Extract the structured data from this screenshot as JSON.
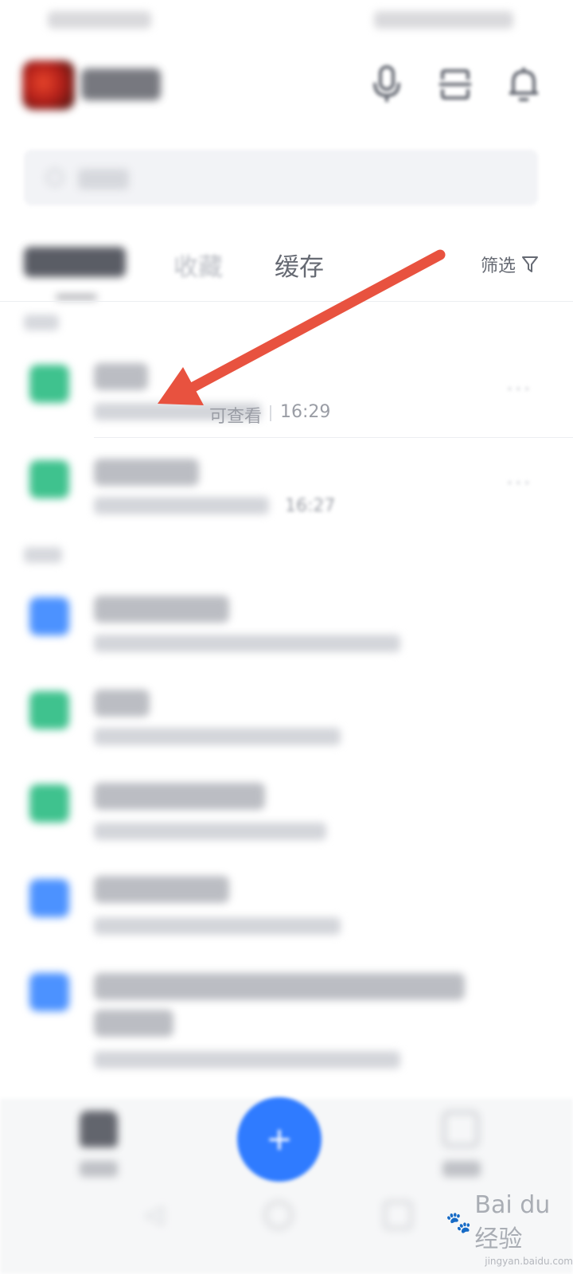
{
  "tabs": {
    "favorites": "收藏",
    "cache": "缓存"
  },
  "filter": {
    "label": "筛选",
    "icon": "filter-icon"
  },
  "list": [
    {
      "type": "sheet",
      "color": "#3fc28e",
      "meta_visible": "可查看",
      "time": "16:29"
    },
    {
      "type": "sheet",
      "color": "#3fc28e",
      "time": "16:27"
    },
    {
      "type": "doc",
      "color": "#4c92ff"
    },
    {
      "type": "sheet",
      "color": "#3fc28e"
    },
    {
      "type": "sheet",
      "color": "#3fc28e"
    },
    {
      "type": "doc",
      "color": "#4c92ff"
    },
    {
      "type": "doc",
      "color": "#4c92ff"
    }
  ],
  "fab_label": "+",
  "header_icons": [
    "microphone-icon",
    "scan-icon",
    "bell-icon"
  ],
  "annotation": {
    "arrow_color": "#e8523f"
  },
  "watermark": {
    "main": "Bai du 经验",
    "sub": "jingyan.baidu.com"
  }
}
